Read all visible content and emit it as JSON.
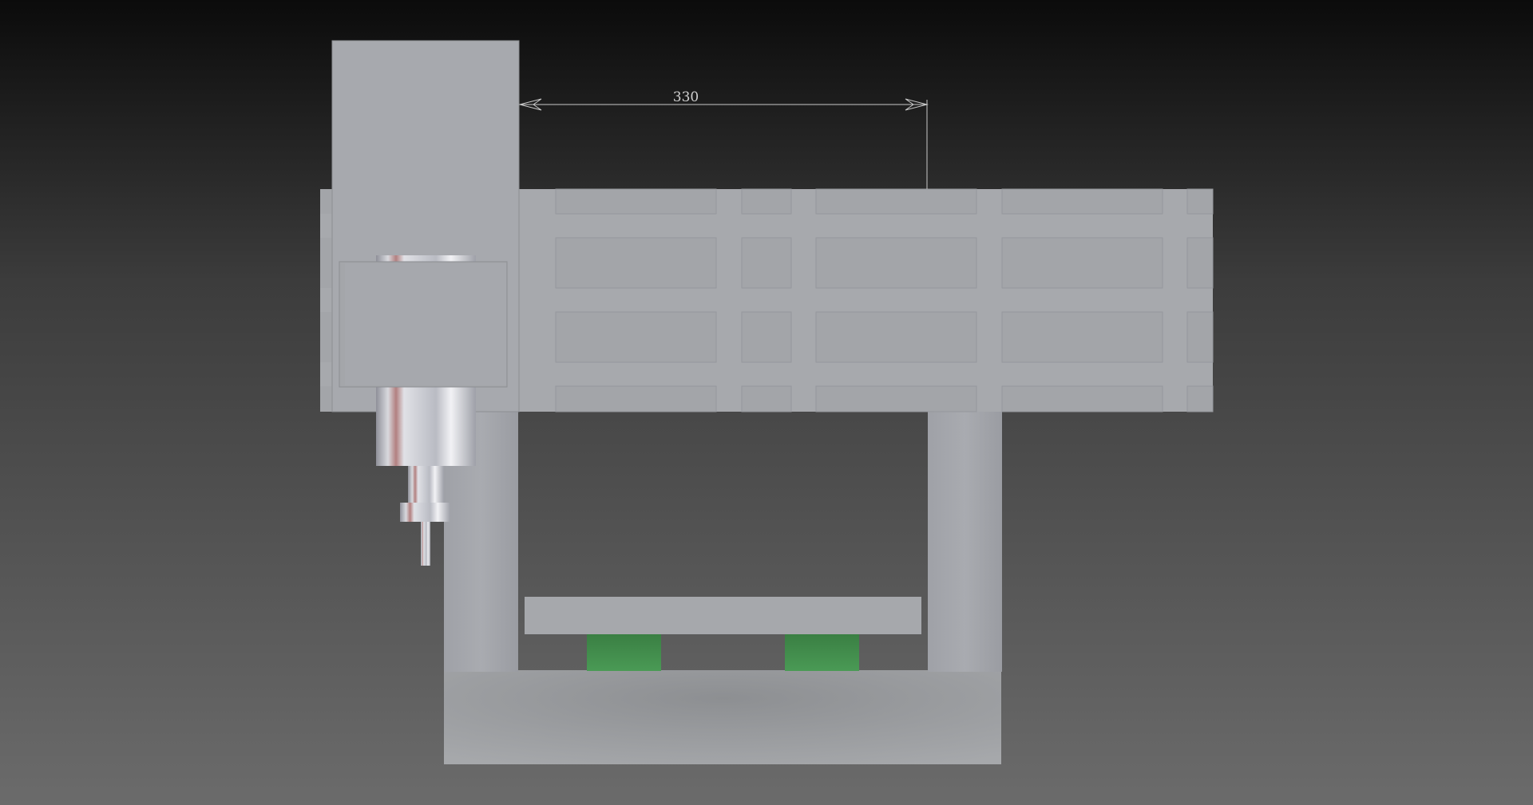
{
  "dimension": {
    "value_label": "330"
  },
  "colors": {
    "background_top": "#0b0b0b",
    "background_bottom": "#6b6b6b",
    "frame": "#a9a9ad",
    "frame_shadow": "#8e9097",
    "beam": "#a7a9ad",
    "recess": "#a2a4a8",
    "spindle_metal": "#c9cbd3",
    "rail_block": "#3e8a48",
    "dimension_line": "#c9c9c9"
  },
  "icons": {
    "dimension_arrow": "open-arrowhead"
  }
}
